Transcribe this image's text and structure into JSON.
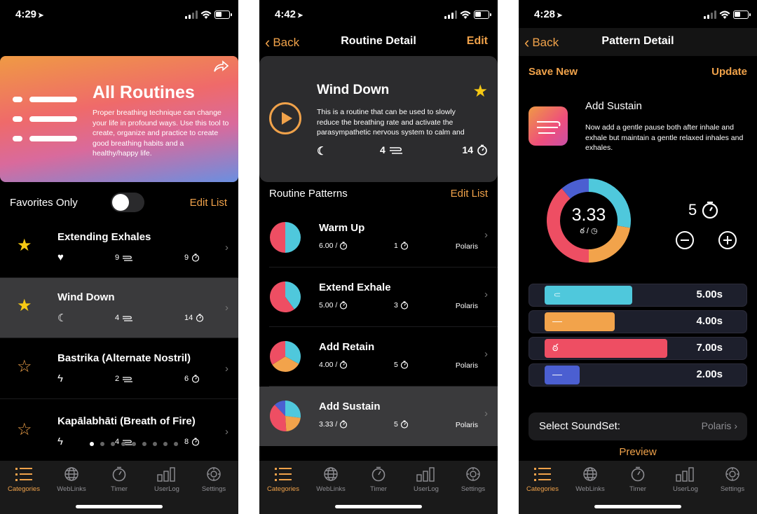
{
  "colors": {
    "accent": "#f0a24a",
    "star": "#f6c914",
    "inhale": "#4fc8dc",
    "exhale": "#f2a34b",
    "retain": "#ee4e63",
    "sustain": "#4b5fd1"
  },
  "tabs": [
    "Categories",
    "WebLinks",
    "Timer",
    "UserLog",
    "Settings"
  ],
  "panel1": {
    "time": "4:29",
    "banner": {
      "title": "All Routines",
      "description": "Proper breathing technique can change your life in profound ways. Use this tool to create, organize and practice to create good breathing habits and a healthy/happy life."
    },
    "favorites_label": "Favorites Only",
    "edit_list": "Edit List",
    "routines": [
      {
        "name": "Extending Exhales",
        "favorite": true,
        "icon": "heart-icon",
        "patterns": "9",
        "minutes": "9"
      },
      {
        "name": "Wind Down",
        "favorite": true,
        "icon": "moon-icon",
        "patterns": "4",
        "minutes": "14"
      },
      {
        "name": "Bastrika (Alternate Nostril)",
        "favorite": false,
        "icon": "bolt-icon",
        "patterns": "2",
        "minutes": "6"
      },
      {
        "name": "Kapālabhāti (Breath of Fire)",
        "favorite": false,
        "icon": "bolt-icon",
        "patterns": "4",
        "minutes": "8"
      }
    ]
  },
  "panel2": {
    "time": "4:42",
    "back": "Back",
    "title": "Routine Detail",
    "edit": "Edit",
    "routine": {
      "name": "Wind Down",
      "description": "This is a routine that can be used to slowly reduce the breathing rate and activate the parasympathetic nervous system to calm and",
      "patterns": "4",
      "minutes": "14"
    },
    "section_label": "Routine Patterns",
    "edit_list": "Edit List",
    "patterns": [
      {
        "name": "Warm Up",
        "rate": "6.00 /",
        "minutes": "1",
        "soundset": "Polaris",
        "slices": [
          0.5,
          0.5
        ]
      },
      {
        "name": "Extend Exhale",
        "rate": "5.00 /",
        "minutes": "3",
        "soundset": "Polaris",
        "slices": [
          0.4,
          0.6
        ]
      },
      {
        "name": "Add Retain",
        "rate": "4.00 /",
        "minutes": "5",
        "soundset": "Polaris",
        "slices": [
          0.33,
          0.33,
          0.34
        ]
      },
      {
        "name": "Add Sustain",
        "rate": "3.33 /",
        "minutes": "5",
        "soundset": "Polaris",
        "slices": [
          0.27,
          0.22,
          0.39,
          0.12
        ]
      }
    ]
  },
  "panel3": {
    "time": "4:28",
    "back": "Back",
    "title": "Pattern Detail",
    "save_new": "Save New",
    "update": "Update",
    "pattern": {
      "name": "Add Sustain",
      "description": "Now add a gentle pause both after inhale and exhale but maintain a gentle relaxed inhales and exhales."
    },
    "rate": "3.33",
    "rate_sub": "/",
    "duration": "5",
    "phases": [
      {
        "name": "Inhale",
        "value": "5.00s",
        "seconds": 5.0,
        "color": "#4fc8dc",
        "icon": "inhale-icon"
      },
      {
        "name": "Exhale",
        "value": "4.00s",
        "seconds": 4.0,
        "color": "#f2a34b",
        "icon": "exhale-icon"
      },
      {
        "name": "Retain",
        "value": "7.00s",
        "seconds": 7.0,
        "color": "#ee4e63",
        "icon": "retain-icon"
      },
      {
        "name": "Sustain",
        "value": "2.00s",
        "seconds": 2.0,
        "color": "#4b5fd1",
        "icon": "sustain-icon"
      }
    ],
    "soundset_label": "Select SoundSet:",
    "soundset_value": "Polaris",
    "preview": "Preview"
  }
}
